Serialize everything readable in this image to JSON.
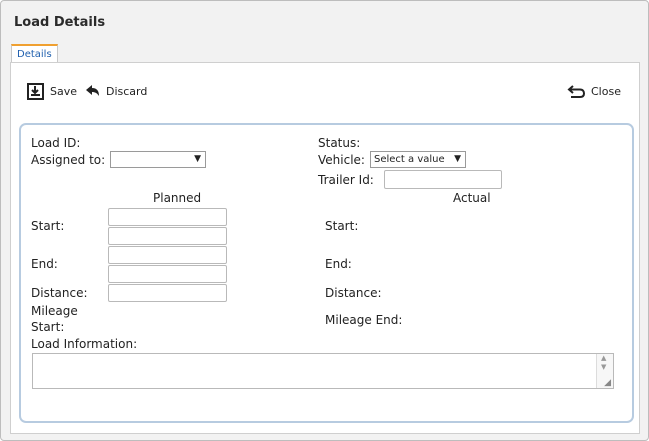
{
  "window": {
    "title": "Load Details"
  },
  "tabs": [
    {
      "label": "Details"
    }
  ],
  "toolbar": {
    "save_label": "Save",
    "discard_label": "Discard",
    "close_label": "Close"
  },
  "form": {
    "load_id_label": "Load ID:",
    "status_label": "Status:",
    "assigned_to_label": "Assigned to:",
    "assigned_to_value": "",
    "vehicle_label": "Vehicle:",
    "vehicle_value": "Select a value",
    "trailer_id_label": "Trailer Id:",
    "trailer_id_value": "",
    "planned_header": "Planned",
    "actual_header": "Actual",
    "start_label": "Start:",
    "end_label": "End:",
    "distance_label": "Distance:",
    "mileage_start_label_line1": "Mileage",
    "mileage_start_label_line2": "Start:",
    "mileage_end_label": "Mileage End:",
    "load_information_label": "Load Information:",
    "load_information_value": ""
  },
  "icons": {
    "save": "save-icon",
    "discard": "undo-arrow-icon",
    "close": "return-arrow-icon",
    "dropdown": "caret-down-icon"
  }
}
